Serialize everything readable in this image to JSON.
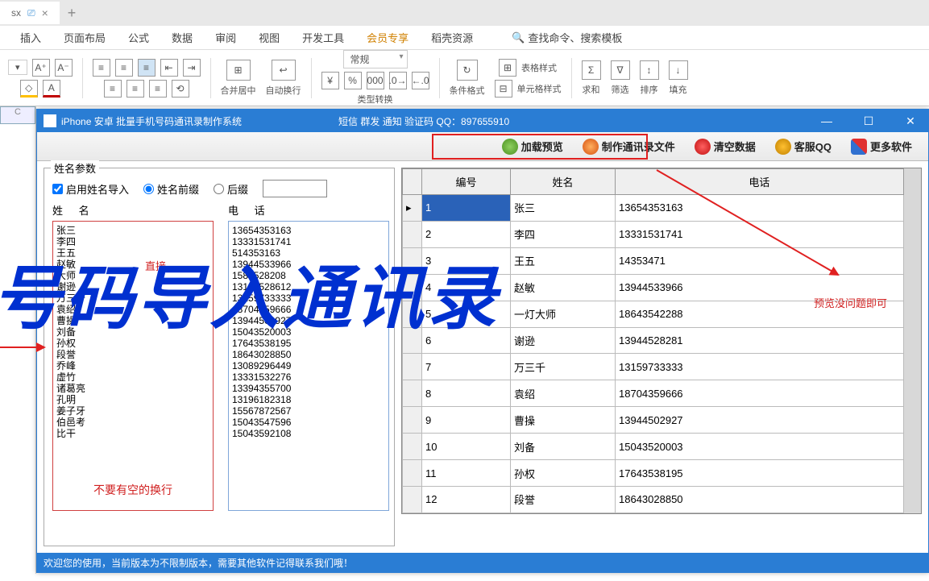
{
  "tabs": {
    "ext": "sx",
    "add": "+"
  },
  "menu": [
    "插入",
    "页面布局",
    "公式",
    "数据",
    "审阅",
    "视图",
    "开发工具",
    "会员专享",
    "稻壳资源"
  ],
  "search_ph": "查找命令、搜索模板",
  "ribbon": {
    "merge": "合并居中",
    "wrap": "自动换行",
    "numfmt": "常规",
    "typeconv": "类型转换",
    "condfmt": "条件格式",
    "tblstyle": "表格样式",
    "cellstyle": "单元格样式",
    "sum": "求和",
    "filter": "筛选",
    "sort": "排序",
    "fill": "填充"
  },
  "dialog": {
    "title": "iPhone 安卓 批量手机号码通讯录制作系统",
    "subtitle": "短信 群发 通知 验证码  QQ：897655910",
    "toolbar": {
      "load": "加载预览",
      "make": "制作通讯录文件",
      "clear": "清空数据",
      "qq": "客服QQ",
      "more": "更多软件"
    },
    "group_title": "姓名参数",
    "chk_enable": "启用姓名导入",
    "radio_prefix": "姓名前缀",
    "radio_suffix": "后缀",
    "col_name": "姓  名",
    "col_phone": "电  话",
    "note_direct": "直接",
    "note_noblank": "不要有空的换行",
    "names": [
      "张三",
      "李四",
      "王五",
      "赵敏",
      "大师",
      "谢逊",
      "万三千",
      "袁绍",
      "曹操",
      "刘备",
      "孙权",
      "段誉",
      "乔峰",
      "虚竹",
      "诸葛亮",
      "孔明",
      "姜子牙",
      "伯邑考",
      "比干"
    ],
    "phones": [
      "13654353163",
      "13331531741",
      "514353163",
      "13944533966",
      "1584528208",
      "13194528612",
      "13159733333",
      "18704359666",
      "13944502927",
      "15043520003",
      "17643538195",
      "18643028850",
      "13089296449",
      "13331532276",
      "13394355700",
      "13196182318",
      "15567872567",
      "15043547596",
      "15043592108"
    ],
    "grid": {
      "h1": "编号",
      "h2": "姓名",
      "h3": "电话",
      "rows": [
        {
          "n": "1",
          "name": "张三",
          "tel": "13654353163"
        },
        {
          "n": "2",
          "name": "李四",
          "tel": "13331531741"
        },
        {
          "n": "3",
          "name": "王五",
          "tel": "14353471"
        },
        {
          "n": "4",
          "name": "赵敏",
          "tel": "13944533966"
        },
        {
          "n": "5",
          "name": "一灯大师",
          "tel": "18643542288"
        },
        {
          "n": "6",
          "name": "谢逊",
          "tel": "13944528281"
        },
        {
          "n": "7",
          "name": "万三千",
          "tel": "13159733333"
        },
        {
          "n": "8",
          "name": "袁绍",
          "tel": "18704359666"
        },
        {
          "n": "9",
          "name": "曹操",
          "tel": "13944502927"
        },
        {
          "n": "10",
          "name": "刘备",
          "tel": "15043520003"
        },
        {
          "n": "11",
          "name": "孙权",
          "tel": "17643538195"
        },
        {
          "n": "12",
          "name": "段誉",
          "tel": "18643028850"
        }
      ]
    },
    "status": "欢迎您的使用，当前版本为不限制版本，需要其他软件记得联系我们哦！"
  },
  "overlay": "号码导入通讯录",
  "small_notes": {
    "preview": "预览没问题即可"
  },
  "cell_c": "C"
}
